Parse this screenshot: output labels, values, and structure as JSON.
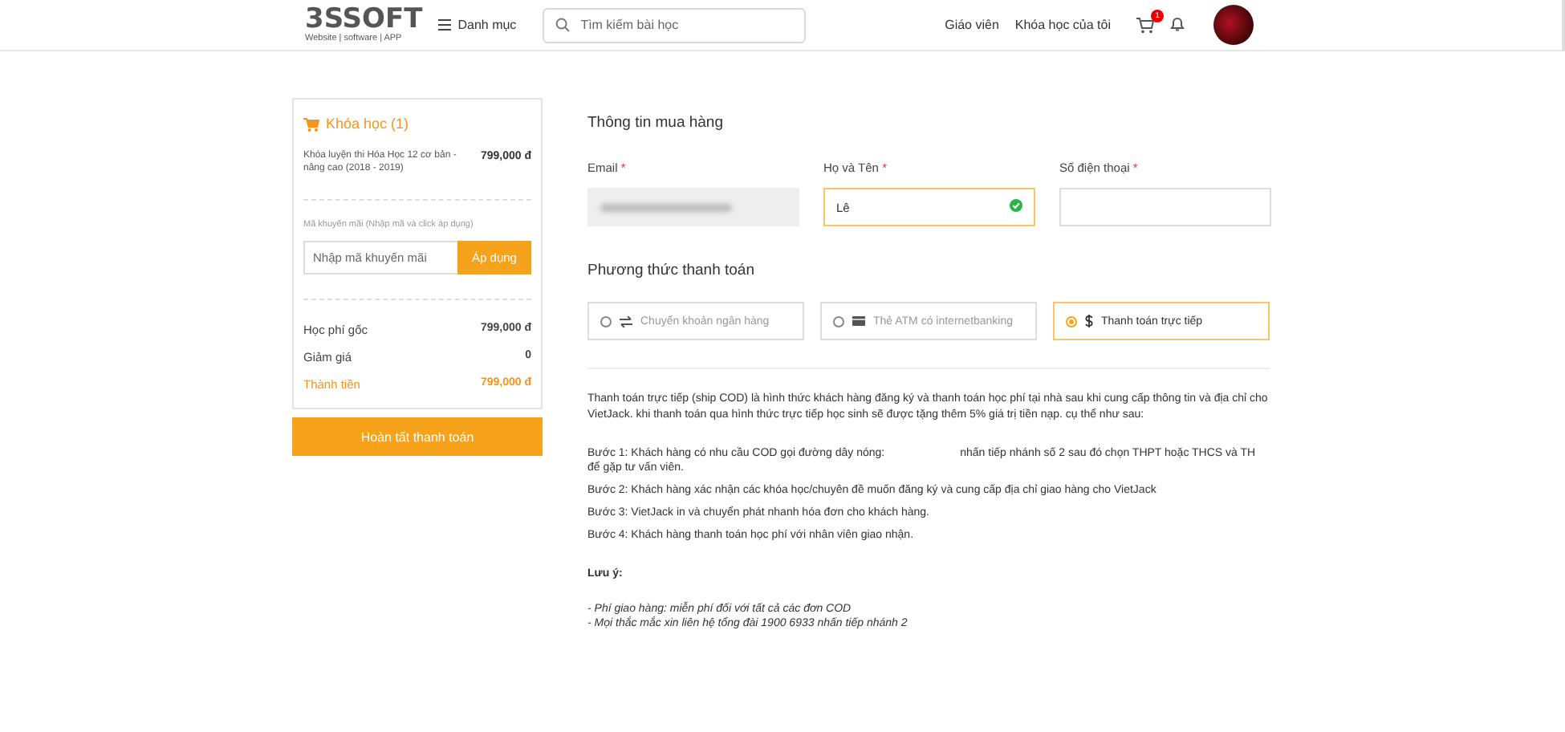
{
  "header": {
    "logo": {
      "name": "3SSOFT",
      "tagline": "Website | software | APP"
    },
    "menu_label": "Danh mục",
    "search": {
      "placeholder": "Tìm kiếm bài học"
    },
    "nav_links": [
      "Giáo viên",
      "Khóa học của tôi"
    ],
    "cart_count": "1"
  },
  "order": {
    "title": "Khóa học (1)",
    "items": [
      {
        "name": "Khóa luyện thi Hóa Học 12 cơ bản - nâng cao (2018 - 2019)",
        "price": "799,000 đ"
      }
    ],
    "promo": {
      "label": "Mã khuyến mãi (Nhập mã và click áp dụng)",
      "placeholder": "Nhập mã khuyến mãi",
      "button": "Áp dụng"
    },
    "totals": [
      {
        "label": "Học phí gốc",
        "value": "799,000 đ",
        "highlight": false
      },
      {
        "label": "Giảm giá",
        "value": "0",
        "highlight": false
      },
      {
        "label": "Thành tiền",
        "value": "799,000 đ",
        "highlight": true
      }
    ],
    "submit": "Hoàn tất thanh toán"
  },
  "buyer": {
    "title": "Thông tin mua hàng",
    "fields": [
      {
        "label": "Email",
        "required_mark": "*",
        "disabled": true,
        "valid": false
      },
      {
        "label": "Họ và Tên",
        "required_mark": "*",
        "value": "Lê",
        "disabled": false,
        "valid": true
      },
      {
        "label": "Số điện thoại",
        "required_mark": "*",
        "disabled": false,
        "valid": false
      }
    ]
  },
  "payment": {
    "title": "Phương thức thanh toán",
    "methods": [
      {
        "kind": "transfer",
        "label": "Chuyển khoản ngân hàng",
        "selected": false
      },
      {
        "kind": "card",
        "label": "Thẻ ATM có internetbanking",
        "selected": false
      },
      {
        "kind": "cash",
        "label": "Thanh toán trực tiếp",
        "selected": true
      }
    ],
    "description": "Thanh toán trực tiếp (ship COD) là hình thức khách hàng đăng ký và thanh toán học phí tại nhà sau khi cung cấp thông tin và địa chỉ cho VietJack. khi thanh toán qua hình thức trực tiếp học sinh sẽ được tặng thêm 5% giá trị tiền nạp. cụ thể như sau:",
    "steps": [
      {
        "before": "Bước 1: Khách hàng có nhu cầu COD gọi đường dây nóng:",
        "after": "nhấn tiếp nhánh số 2 sau đó chọn THPT hoặc THCS và TH",
        "continuation": "để gặp tư vấn viên."
      },
      {
        "before": "Bước 2: Khách hàng xác nhận các khóa học/chuyên đề muốn đăng ký và cung cấp địa chỉ giao hàng cho VietJack"
      },
      {
        "before": "Bước 3: VietJack in và chuyển phát nhanh hóa đơn cho khách hàng."
      },
      {
        "before": "Bước 4: Khách hàng thanh toán học phí với nhân viên giao nhận."
      }
    ],
    "note_title": "Lưu ý:",
    "notes": [
      "- Phí giao hàng: miễn phí đối với tất cả các đơn COD",
      "- Mọi thắc mắc xin liên hệ tổng đài 1900 6933 nhấn tiếp nhánh 2"
    ]
  }
}
